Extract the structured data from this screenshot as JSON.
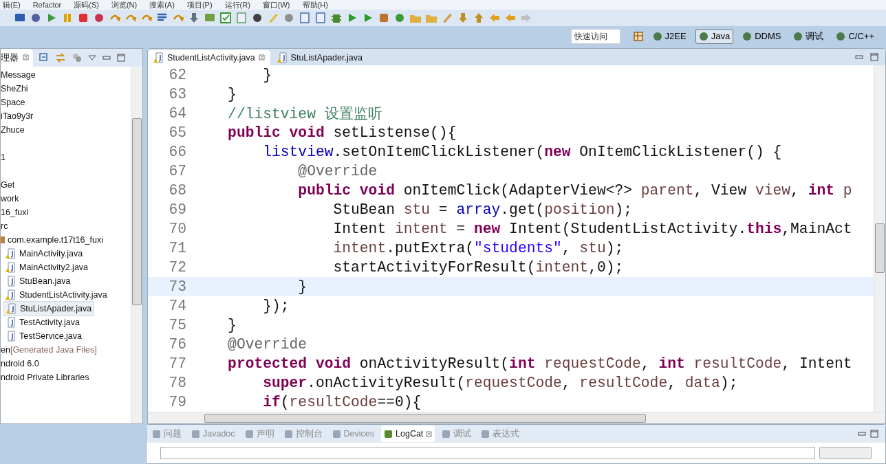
{
  "menu": [
    "辑(E)",
    "Refactor",
    "源码(S)",
    "浏览(N)",
    "搜索(A)",
    "项目(P)",
    "运行(R)",
    "窗口(W)",
    "帮助(H)"
  ],
  "quick_access": {
    "placeholder": "快速访问"
  },
  "perspectives": [
    {
      "label": "J2EE",
      "selected": false
    },
    {
      "label": "Java",
      "selected": true
    },
    {
      "label": "DDMS",
      "selected": false
    },
    {
      "label": "调试",
      "selected": false
    },
    {
      "label": "C/C++",
      "selected": false
    }
  ],
  "explorer": {
    "title": "理器",
    "items": [
      {
        "label": "Message",
        "gap_before": false
      },
      {
        "label": "SheZhi",
        "gap_before": false
      },
      {
        "label": "Space",
        "gap_before": false
      },
      {
        "label": "iTao9y3r",
        "gap_before": false
      },
      {
        "label": "Zhuce",
        "gap_before": false
      },
      {
        "label": "1",
        "gap_before": true
      },
      {
        "label": "Get",
        "gap_before": true
      },
      {
        "label": "work",
        "gap_before": false
      },
      {
        "label": "16_fuxi",
        "gap_before": false
      },
      {
        "label": "rc",
        "gap_before": false
      },
      {
        "label": "com.example.t17t16_fuxi",
        "gap_before": false,
        "kind": "package",
        "children": [
          {
            "label": "MainActivity.java",
            "warning": true,
            "selected": false
          },
          {
            "label": "MainActivity2.java",
            "warning": true,
            "selected": false
          },
          {
            "label": "StuBean.java",
            "warning": false,
            "selected": false
          },
          {
            "label": "StudentListActivity.java",
            "warning": true,
            "selected": false
          },
          {
            "label": "StuListApader.java",
            "warning": true,
            "selected": true
          },
          {
            "label": "TestActivity.java",
            "warning": false,
            "selected": false
          },
          {
            "label": "TestService.java",
            "warning": false,
            "selected": false
          }
        ]
      },
      {
        "label": "en",
        "gap_before": false,
        "note": "[Generated Java Files]"
      },
      {
        "label": "ndroid 6.0",
        "gap_before": false
      },
      {
        "label": "ndroid Private Libraries",
        "gap_before": false
      }
    ]
  },
  "editor_tabs": [
    {
      "label": "StudentListActivity.java",
      "selected": true,
      "warning": true
    },
    {
      "label": "StuListApader.java",
      "selected": false,
      "warning": true
    }
  ],
  "code": [
    {
      "n": "62",
      "current": false,
      "t": [
        {
          "kind": "plain",
          "text": "        }"
        }
      ]
    },
    {
      "n": "63",
      "current": false,
      "t": [
        {
          "kind": "plain",
          "text": "    }"
        }
      ]
    },
    {
      "n": "64",
      "current": false,
      "t": [
        {
          "kind": "comment",
          "text": "    //listview 设置监听"
        }
      ]
    },
    {
      "n": "65",
      "current": false,
      "t": [
        {
          "kind": "keyword",
          "text": "    public"
        },
        {
          "kind": "keyword",
          "text": " void"
        },
        {
          "kind": "plain",
          "text": " setListense(){"
        }
      ]
    },
    {
      "n": "66",
      "current": false,
      "t": [
        {
          "kind": "field",
          "text": "        listview"
        },
        {
          "kind": "plain",
          "text": ".setOnItemClickListener("
        },
        {
          "kind": "keyword",
          "text": "new"
        },
        {
          "kind": "plain",
          "text": " OnItemClickListener() {"
        }
      ]
    },
    {
      "n": "67",
      "current": false,
      "t": [
        {
          "kind": "annotation",
          "text": "            @Override"
        }
      ]
    },
    {
      "n": "68",
      "current": false,
      "t": [
        {
          "kind": "keyword",
          "text": "            public"
        },
        {
          "kind": "keyword",
          "text": " void"
        },
        {
          "kind": "plain",
          "text": " onItemClick(AdapterView<?>"
        },
        {
          "kind": "local",
          "text": " parent"
        },
        {
          "kind": "plain",
          "text": ", View"
        },
        {
          "kind": "local",
          "text": " view"
        },
        {
          "kind": "plain",
          "text": ","
        },
        {
          "kind": "keyword",
          "text": " int"
        },
        {
          "kind": "local",
          "text": " p"
        }
      ]
    },
    {
      "n": "69",
      "current": false,
      "t": [
        {
          "kind": "plain",
          "text": "                StuBean"
        },
        {
          "kind": "local",
          "text": " stu"
        },
        {
          "kind": "plain",
          "text": " ="
        },
        {
          "kind": "field",
          "text": " array"
        },
        {
          "kind": "plain",
          "text": ".get("
        },
        {
          "kind": "local",
          "text": "position"
        },
        {
          "kind": "plain",
          "text": ");"
        }
      ]
    },
    {
      "n": "70",
      "current": false,
      "t": [
        {
          "kind": "plain",
          "text": "                Intent"
        },
        {
          "kind": "local",
          "text": " intent"
        },
        {
          "kind": "plain",
          "text": " ="
        },
        {
          "kind": "keyword",
          "text": " new"
        },
        {
          "kind": "plain",
          "text": " Intent(StudentListActivity."
        },
        {
          "kind": "keyword",
          "text": "this"
        },
        {
          "kind": "plain",
          "text": ",MainAct"
        }
      ]
    },
    {
      "n": "71",
      "current": false,
      "t": [
        {
          "kind": "local",
          "text": "                intent"
        },
        {
          "kind": "plain",
          "text": ".putExtra("
        },
        {
          "kind": "string",
          "text": "\"students\""
        },
        {
          "kind": "plain",
          "text": ","
        },
        {
          "kind": "local",
          "text": " stu"
        },
        {
          "kind": "plain",
          "text": ");"
        }
      ]
    },
    {
      "n": "72",
      "current": false,
      "t": [
        {
          "kind": "plain",
          "text": "                startActivityForResult("
        },
        {
          "kind": "local",
          "text": "intent"
        },
        {
          "kind": "plain",
          "text": ",0);"
        }
      ]
    },
    {
      "n": "73",
      "current": true,
      "t": [
        {
          "kind": "plain",
          "text": "            }"
        }
      ]
    },
    {
      "n": "74",
      "current": false,
      "t": [
        {
          "kind": "plain",
          "text": "        });"
        }
      ]
    },
    {
      "n": "75",
      "current": false,
      "t": [
        {
          "kind": "plain",
          "text": "    }"
        }
      ]
    },
    {
      "n": "76",
      "current": false,
      "t": [
        {
          "kind": "annotation",
          "text": "    @Override"
        }
      ]
    },
    {
      "n": "77",
      "current": false,
      "t": [
        {
          "kind": "keyword",
          "text": "    protected"
        },
        {
          "kind": "keyword",
          "text": " void"
        },
        {
          "kind": "plain",
          "text": " onActivityResult("
        },
        {
          "kind": "keyword",
          "text": "int"
        },
        {
          "kind": "local",
          "text": " requestCode"
        },
        {
          "kind": "plain",
          "text": ","
        },
        {
          "kind": "keyword",
          "text": " int"
        },
        {
          "kind": "local",
          "text": " resultCode"
        },
        {
          "kind": "plain",
          "text": ", Intent"
        }
      ]
    },
    {
      "n": "78",
      "current": false,
      "t": [
        {
          "kind": "keyword",
          "text": "        super"
        },
        {
          "kind": "plain",
          "text": ".onActivityResult("
        },
        {
          "kind": "local",
          "text": "requestCode"
        },
        {
          "kind": "plain",
          "text": ","
        },
        {
          "kind": "local",
          "text": " resultCode"
        },
        {
          "kind": "plain",
          "text": ","
        },
        {
          "kind": "local",
          "text": " data"
        },
        {
          "kind": "plain",
          "text": ");"
        }
      ]
    },
    {
      "n": "79",
      "current": false,
      "t": [
        {
          "kind": "keyword",
          "text": "        if"
        },
        {
          "kind": "plain",
          "text": "("
        },
        {
          "kind": "local",
          "text": "resultCode"
        },
        {
          "kind": "plain",
          "text": "==0){"
        }
      ]
    }
  ],
  "bottom_tabs": [
    {
      "label": "问题",
      "selected": false
    },
    {
      "label": "Javadoc",
      "selected": false
    },
    {
      "label": "声明",
      "selected": false
    },
    {
      "label": "控制台",
      "selected": false
    },
    {
      "label": "Devices",
      "selected": false
    },
    {
      "label": "LogCat",
      "selected": true
    },
    {
      "label": "调试",
      "selected": false
    },
    {
      "label": "表达式",
      "selected": false
    }
  ]
}
